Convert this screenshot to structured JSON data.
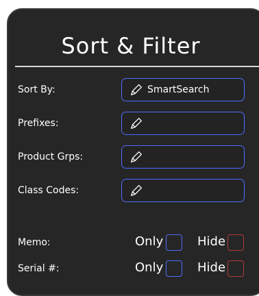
{
  "header": {
    "title": "Sort & Filter"
  },
  "fields": {
    "sort_by": {
      "label": "Sort By:",
      "value": "SmartSearch"
    },
    "prefixes": {
      "label": "Prefixes:",
      "value": ""
    },
    "product_grps": {
      "label": "Product Grps:",
      "value": ""
    },
    "class_codes": {
      "label": "Class Codes:",
      "value": ""
    }
  },
  "toggles": {
    "memo": {
      "label": "Memo:",
      "only_label": "Only",
      "hide_label": "Hide"
    },
    "serial": {
      "label": "Serial #:",
      "only_label": "Only",
      "hide_label": "Hide"
    }
  },
  "colors": {
    "panel_bg": "#262626",
    "accent_blue": "#4f6bff",
    "accent_red": "#b33a3a"
  },
  "icons": {
    "field_icon": "pencil-icon"
  }
}
